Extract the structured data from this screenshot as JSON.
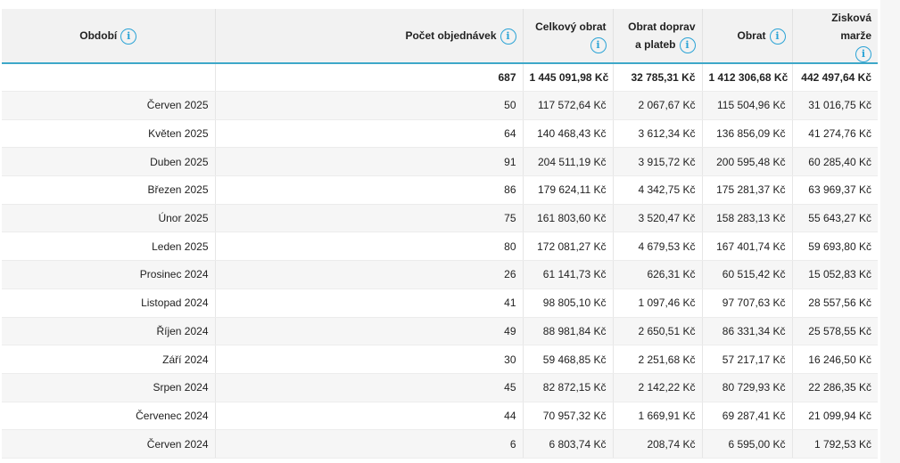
{
  "headers": [
    {
      "label": "Období",
      "key": "period"
    },
    {
      "label": "Počet objednávek",
      "key": "orders"
    },
    {
      "label": "Celkový obrat",
      "key": "total_turnover"
    },
    {
      "label": "Obrat doprav a plateb",
      "key": "shipping_payment_turnover"
    },
    {
      "label": "Obrat",
      "key": "turnover"
    },
    {
      "label": "Zisková marže",
      "key": "margin"
    }
  ],
  "info_icon": "info-icon",
  "totals": {
    "period": "",
    "orders": "687",
    "total_turnover": "1 445 091,98 Kč",
    "shipping_payment_turnover": "32 785,31 Kč",
    "turnover": "1 412 306,68 Kč",
    "margin": "442 497,64 Kč"
  },
  "rows": [
    {
      "period": "Červen 2025",
      "orders": "50",
      "total_turnover": "117 572,64 Kč",
      "shipping_payment_turnover": "2 067,67 Kč",
      "turnover": "115 504,96 Kč",
      "margin": "31 016,75 Kč"
    },
    {
      "period": "Květen 2025",
      "orders": "64",
      "total_turnover": "140 468,43 Kč",
      "shipping_payment_turnover": "3 612,34 Kč",
      "turnover": "136 856,09 Kč",
      "margin": "41 274,76 Kč"
    },
    {
      "period": "Duben 2025",
      "orders": "91",
      "total_turnover": "204 511,19 Kč",
      "shipping_payment_turnover": "3 915,72 Kč",
      "turnover": "200 595,48 Kč",
      "margin": "60 285,40 Kč"
    },
    {
      "period": "Březen 2025",
      "orders": "86",
      "total_turnover": "179 624,11 Kč",
      "shipping_payment_turnover": "4 342,75 Kč",
      "turnover": "175 281,37 Kč",
      "margin": "63 969,37 Kč"
    },
    {
      "period": "Únor 2025",
      "orders": "75",
      "total_turnover": "161 803,60 Kč",
      "shipping_payment_turnover": "3 520,47 Kč",
      "turnover": "158 283,13 Kč",
      "margin": "55 643,27 Kč"
    },
    {
      "period": "Leden 2025",
      "orders": "80",
      "total_turnover": "172 081,27 Kč",
      "shipping_payment_turnover": "4 679,53 Kč",
      "turnover": "167 401,74 Kč",
      "margin": "59 693,80 Kč"
    },
    {
      "period": "Prosinec 2024",
      "orders": "26",
      "total_turnover": "61 141,73 Kč",
      "shipping_payment_turnover": "626,31 Kč",
      "turnover": "60 515,42 Kč",
      "margin": "15 052,83 Kč"
    },
    {
      "period": "Listopad 2024",
      "orders": "41",
      "total_turnover": "98 805,10 Kč",
      "shipping_payment_turnover": "1 097,46 Kč",
      "turnover": "97 707,63 Kč",
      "margin": "28 557,56 Kč"
    },
    {
      "period": "Říjen 2024",
      "orders": "49",
      "total_turnover": "88 981,84 Kč",
      "shipping_payment_turnover": "2 650,51 Kč",
      "turnover": "86 331,34 Kč",
      "margin": "25 578,55 Kč"
    },
    {
      "period": "Září 2024",
      "orders": "30",
      "total_turnover": "59 468,85 Kč",
      "shipping_payment_turnover": "2 251,68 Kč",
      "turnover": "57 217,17 Kč",
      "margin": "16 246,50 Kč"
    },
    {
      "period": "Srpen 2024",
      "orders": "45",
      "total_turnover": "82 872,15 Kč",
      "shipping_payment_turnover": "2 142,22 Kč",
      "turnover": "80 729,93 Kč",
      "margin": "22 286,35 Kč"
    },
    {
      "period": "Červenec 2024",
      "orders": "44",
      "total_turnover": "70 957,32 Kč",
      "shipping_payment_turnover": "1 669,91 Kč",
      "turnover": "69 287,41 Kč",
      "margin": "21 099,94 Kč"
    },
    {
      "period": "Červen 2024",
      "orders": "6",
      "total_turnover": "6 803,74 Kč",
      "shipping_payment_turnover": "208,74 Kč",
      "turnover": "6 595,00 Kč",
      "margin": "1 792,53 Kč"
    }
  ],
  "colors": {
    "accent": "#3ea8c9",
    "info_icon": "#2aa3d6",
    "header_bg": "#f2f2f2"
  }
}
